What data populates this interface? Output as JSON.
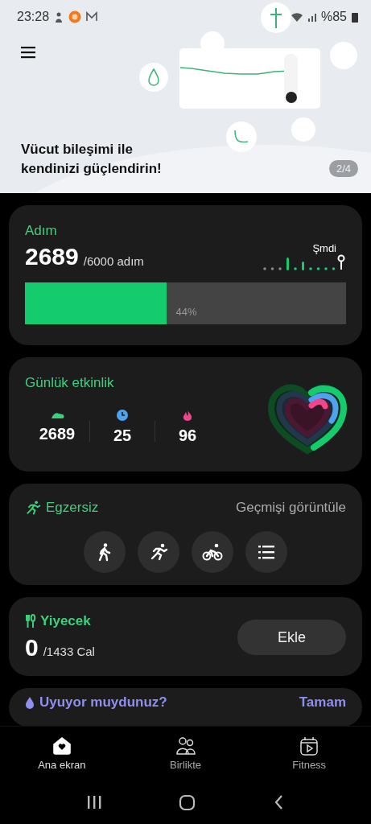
{
  "status_bar": {
    "time": "23:28",
    "battery": "%85"
  },
  "banner": {
    "title": "Vücut bileşimi ile kendinizi güçlendirin!",
    "page": "2/4"
  },
  "steps": {
    "title": "Adım",
    "count": "2689",
    "goal": "/6000 adım",
    "now_label": "Şmdi",
    "level": 0.44,
    "percent": "44%"
  },
  "activity": {
    "title": "Günlük etkinlik",
    "stats": [
      {
        "kind": "steps",
        "value": "2689"
      },
      {
        "kind": "time",
        "value": "25"
      },
      {
        "kind": "calories",
        "value": "96"
      }
    ]
  },
  "exercise": {
    "title": "Egzersiz",
    "history_link": "Geçmişi görüntüle",
    "types": [
      {
        "kind": "walk"
      },
      {
        "kind": "run"
      },
      {
        "kind": "bike"
      },
      {
        "kind": "list"
      }
    ]
  },
  "food": {
    "title": "Yiyecek",
    "count": "0",
    "goal": "/1433 Cal",
    "button": "Ekle"
  },
  "sleep": {
    "title": "Uyuyor muydunuz?",
    "action": "Tamam"
  },
  "bottom_nav": [
    {
      "kind": "home",
      "label": "Ana ekran",
      "selected": true
    },
    {
      "kind": "together",
      "label": "Birlikte",
      "selected": false
    },
    {
      "kind": "fitness",
      "label": "Fitness",
      "selected": false
    }
  ]
}
